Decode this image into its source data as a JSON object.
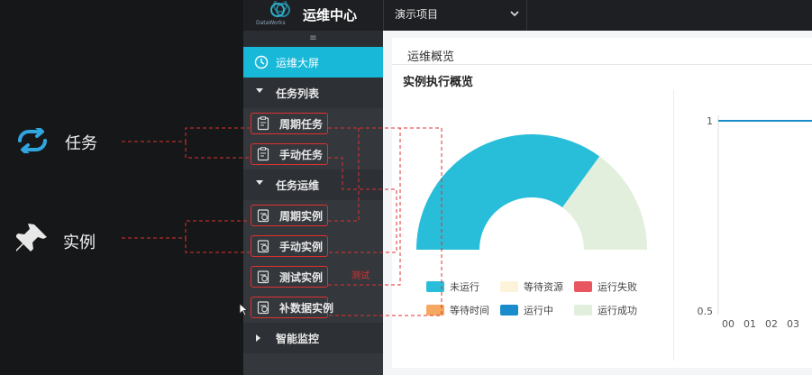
{
  "slide": {
    "task_label": "任务",
    "instance_label": "实例"
  },
  "app": {
    "logo_text": "DataWorks",
    "brand": "运维中心",
    "project": "演示项目"
  },
  "sidebar": {
    "hamburger": "≡",
    "items": [
      {
        "label": "运维大屏",
        "type": "active"
      },
      {
        "label": "任务列表",
        "type": "group"
      },
      {
        "label": "周期任务",
        "type": "child"
      },
      {
        "label": "手动任务",
        "type": "child"
      },
      {
        "label": "任务运维",
        "type": "group"
      },
      {
        "label": "周期实例",
        "type": "child"
      },
      {
        "label": "手动实例",
        "type": "child"
      },
      {
        "label": "测试实例",
        "type": "child"
      },
      {
        "label": "补数据实例",
        "type": "child"
      },
      {
        "label": "智能监控",
        "type": "group"
      }
    ]
  },
  "main": {
    "breadcrumb": "运维概览",
    "section_title": "实例执行概览",
    "annotation_note": "测试"
  },
  "chart_data": [
    {
      "type": "pie",
      "title": "",
      "style": "semicircle-donut",
      "slices": [
        {
          "name": "未运行",
          "value": 70,
          "color": "#28bdd8"
        },
        {
          "name": "等待资源",
          "value": 0,
          "color": "#fdf3da"
        },
        {
          "name": "运行失败",
          "value": 0,
          "color": "#e8575f"
        },
        {
          "name": "等待时间",
          "value": 0,
          "color": "#f5a860"
        },
        {
          "name": "运行中",
          "value": 0,
          "color": "#1a8ccc"
        },
        {
          "name": "运行成功",
          "value": 30,
          "color": "#e2efdd"
        }
      ]
    },
    {
      "type": "line",
      "title": "",
      "xlabel": "",
      "ylabel": "",
      "x_ticks": [
        "00",
        "01",
        "02",
        "03"
      ],
      "y_ticks": [
        "1",
        "0.5"
      ],
      "ylim": [
        0.5,
        1
      ],
      "series": [
        {
          "values": [
            1,
            1,
            1,
            1
          ],
          "color": "#1a8ccc"
        }
      ]
    }
  ]
}
